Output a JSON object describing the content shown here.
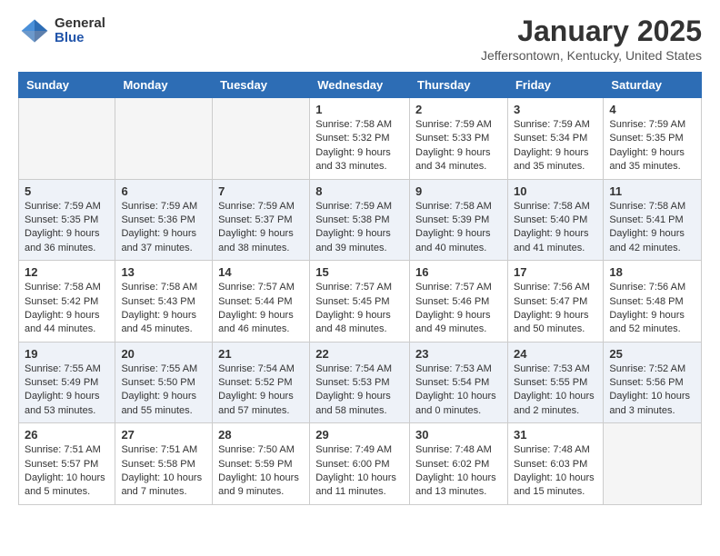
{
  "header": {
    "logo_general": "General",
    "logo_blue": "Blue",
    "title": "January 2025",
    "location": "Jeffersontown, Kentucky, United States"
  },
  "weekdays": [
    "Sunday",
    "Monday",
    "Tuesday",
    "Wednesday",
    "Thursday",
    "Friday",
    "Saturday"
  ],
  "weeks": [
    [
      {
        "day": "",
        "info": ""
      },
      {
        "day": "",
        "info": ""
      },
      {
        "day": "",
        "info": ""
      },
      {
        "day": "1",
        "info": "Sunrise: 7:58 AM\nSunset: 5:32 PM\nDaylight: 9 hours\nand 33 minutes."
      },
      {
        "day": "2",
        "info": "Sunrise: 7:59 AM\nSunset: 5:33 PM\nDaylight: 9 hours\nand 34 minutes."
      },
      {
        "day": "3",
        "info": "Sunrise: 7:59 AM\nSunset: 5:34 PM\nDaylight: 9 hours\nand 35 minutes."
      },
      {
        "day": "4",
        "info": "Sunrise: 7:59 AM\nSunset: 5:35 PM\nDaylight: 9 hours\nand 35 minutes."
      }
    ],
    [
      {
        "day": "5",
        "info": "Sunrise: 7:59 AM\nSunset: 5:35 PM\nDaylight: 9 hours\nand 36 minutes."
      },
      {
        "day": "6",
        "info": "Sunrise: 7:59 AM\nSunset: 5:36 PM\nDaylight: 9 hours\nand 37 minutes."
      },
      {
        "day": "7",
        "info": "Sunrise: 7:59 AM\nSunset: 5:37 PM\nDaylight: 9 hours\nand 38 minutes."
      },
      {
        "day": "8",
        "info": "Sunrise: 7:59 AM\nSunset: 5:38 PM\nDaylight: 9 hours\nand 39 minutes."
      },
      {
        "day": "9",
        "info": "Sunrise: 7:58 AM\nSunset: 5:39 PM\nDaylight: 9 hours\nand 40 minutes."
      },
      {
        "day": "10",
        "info": "Sunrise: 7:58 AM\nSunset: 5:40 PM\nDaylight: 9 hours\nand 41 minutes."
      },
      {
        "day": "11",
        "info": "Sunrise: 7:58 AM\nSunset: 5:41 PM\nDaylight: 9 hours\nand 42 minutes."
      }
    ],
    [
      {
        "day": "12",
        "info": "Sunrise: 7:58 AM\nSunset: 5:42 PM\nDaylight: 9 hours\nand 44 minutes."
      },
      {
        "day": "13",
        "info": "Sunrise: 7:58 AM\nSunset: 5:43 PM\nDaylight: 9 hours\nand 45 minutes."
      },
      {
        "day": "14",
        "info": "Sunrise: 7:57 AM\nSunset: 5:44 PM\nDaylight: 9 hours\nand 46 minutes."
      },
      {
        "day": "15",
        "info": "Sunrise: 7:57 AM\nSunset: 5:45 PM\nDaylight: 9 hours\nand 48 minutes."
      },
      {
        "day": "16",
        "info": "Sunrise: 7:57 AM\nSunset: 5:46 PM\nDaylight: 9 hours\nand 49 minutes."
      },
      {
        "day": "17",
        "info": "Sunrise: 7:56 AM\nSunset: 5:47 PM\nDaylight: 9 hours\nand 50 minutes."
      },
      {
        "day": "18",
        "info": "Sunrise: 7:56 AM\nSunset: 5:48 PM\nDaylight: 9 hours\nand 52 minutes."
      }
    ],
    [
      {
        "day": "19",
        "info": "Sunrise: 7:55 AM\nSunset: 5:49 PM\nDaylight: 9 hours\nand 53 minutes."
      },
      {
        "day": "20",
        "info": "Sunrise: 7:55 AM\nSunset: 5:50 PM\nDaylight: 9 hours\nand 55 minutes."
      },
      {
        "day": "21",
        "info": "Sunrise: 7:54 AM\nSunset: 5:52 PM\nDaylight: 9 hours\nand 57 minutes."
      },
      {
        "day": "22",
        "info": "Sunrise: 7:54 AM\nSunset: 5:53 PM\nDaylight: 9 hours\nand 58 minutes."
      },
      {
        "day": "23",
        "info": "Sunrise: 7:53 AM\nSunset: 5:54 PM\nDaylight: 10 hours\nand 0 minutes."
      },
      {
        "day": "24",
        "info": "Sunrise: 7:53 AM\nSunset: 5:55 PM\nDaylight: 10 hours\nand 2 minutes."
      },
      {
        "day": "25",
        "info": "Sunrise: 7:52 AM\nSunset: 5:56 PM\nDaylight: 10 hours\nand 3 minutes."
      }
    ],
    [
      {
        "day": "26",
        "info": "Sunrise: 7:51 AM\nSunset: 5:57 PM\nDaylight: 10 hours\nand 5 minutes."
      },
      {
        "day": "27",
        "info": "Sunrise: 7:51 AM\nSunset: 5:58 PM\nDaylight: 10 hours\nand 7 minutes."
      },
      {
        "day": "28",
        "info": "Sunrise: 7:50 AM\nSunset: 5:59 PM\nDaylight: 10 hours\nand 9 minutes."
      },
      {
        "day": "29",
        "info": "Sunrise: 7:49 AM\nSunset: 6:00 PM\nDaylight: 10 hours\nand 11 minutes."
      },
      {
        "day": "30",
        "info": "Sunrise: 7:48 AM\nSunset: 6:02 PM\nDaylight: 10 hours\nand 13 minutes."
      },
      {
        "day": "31",
        "info": "Sunrise: 7:48 AM\nSunset: 6:03 PM\nDaylight: 10 hours\nand 15 minutes."
      },
      {
        "day": "",
        "info": ""
      }
    ]
  ]
}
